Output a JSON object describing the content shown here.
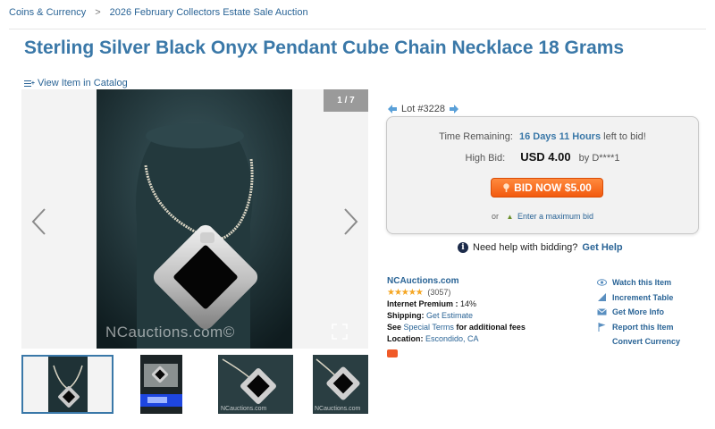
{
  "breadcrumb": {
    "items": [
      "Coins & Currency",
      "2026 February Collectors Estate Sale Auction"
    ],
    "separator": ">"
  },
  "title": "Sterling Silver Black Onyx Pendant Cube Chain Necklace 18 Grams",
  "catalog_link": "View Item in Catalog",
  "gallery": {
    "counter": "1 / 7",
    "watermark": "NCauctions.com©",
    "thumb_watermark": "NCauctions.com"
  },
  "lot": "Lot #3228",
  "bid": {
    "time_label": "Time Remaining:",
    "time_value": "16 Days 11 Hours",
    "time_suffix": "left to bid!",
    "high_bid_label": "High Bid:",
    "high_bid_amount": "USD 4.00",
    "high_bid_by": "by D****1",
    "bid_now_label": "BID NOW $5.00",
    "or_text": "or",
    "max_bid_label": "Enter a maximum bid"
  },
  "help": {
    "text": "Need help with bidding?",
    "link": "Get Help"
  },
  "seller": {
    "name": "NCAuctions.com",
    "rating": 5,
    "stars": "★★★★★",
    "rating_count": "(3057)",
    "premium_label": "Internet Premium :",
    "premium_value": "14%",
    "shipping_label": "Shipping:",
    "shipping_link": "Get Estimate",
    "see_text": "See",
    "terms_link": "Special Terms",
    "terms_suffix": "for additional fees",
    "location_label": "Location:",
    "location_value": "Escondido, CA"
  },
  "actions": {
    "watch": "Watch this Item",
    "increment": "Increment Table",
    "info": "Get More Info",
    "report": "Report this Item",
    "currency": "Convert Currency"
  },
  "colors": {
    "link": "#2a6496",
    "title": "#3a78a8",
    "bid_button": "#f25a0f",
    "stars": "#f5a623"
  }
}
